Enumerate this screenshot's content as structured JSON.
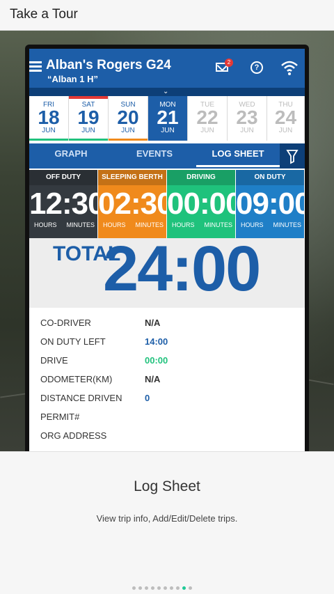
{
  "window": {
    "title": "Take a Tour"
  },
  "app": {
    "driver_name": "Alban's Rogers G24",
    "driver_sub": "“Alban 1 H”",
    "mail_badge": "2",
    "help_glyph": "?"
  },
  "days": [
    {
      "dow": "FRI",
      "num": "18",
      "mon": "JUN"
    },
    {
      "dow": "SAT",
      "num": "19",
      "mon": "JUN"
    },
    {
      "dow": "SUN",
      "num": "20",
      "mon": "JUN"
    },
    {
      "dow": "MON",
      "num": "21",
      "mon": "JUN"
    },
    {
      "dow": "TUE",
      "num": "22",
      "mon": "JUN"
    },
    {
      "dow": "WED",
      "num": "23",
      "mon": "JUN"
    },
    {
      "dow": "THU",
      "num": "24",
      "mon": "JUN"
    }
  ],
  "tabs": [
    {
      "label": "GRAPH"
    },
    {
      "label": "EVENTS"
    },
    {
      "label": "LOG SHEET"
    }
  ],
  "statuses": [
    {
      "label": "OFF DUTY",
      "time": "12:30",
      "color": "#343a40"
    },
    {
      "label": "SLEEPING BERTH",
      "time": "02:30",
      "color": "#f08a1c"
    },
    {
      "label": "DRIVING",
      "time": "00:00",
      "color": "#1fc27c"
    },
    {
      "label": "ON DUTY",
      "time": "09:00",
      "color": "#1f7fc7"
    }
  ],
  "units": {
    "hours": "HOURS",
    "minutes": "MINUTES"
  },
  "total": {
    "label": "TOTAL",
    "value": "24:00"
  },
  "info": [
    {
      "key": "CO-DRIVER",
      "value": "N/A",
      "color": "#333333"
    },
    {
      "key": "ON DUTY LEFT",
      "value": "14:00",
      "color": "#1d5ea8"
    },
    {
      "key": "DRIVE",
      "value": "00:00",
      "color": "#21c27d"
    },
    {
      "key": "ODOMETER(KM)",
      "value": "N/A",
      "color": "#333333"
    },
    {
      "key": "DISTANCE DRIVEN",
      "value": "0",
      "color": "#1d5ea8"
    },
    {
      "key": "PERMIT#",
      "value": "",
      "color": "#333333"
    },
    {
      "key": "ORG ADDRESS",
      "value": "",
      "color": "#333333"
    }
  ],
  "tour": {
    "title": "Log Sheet",
    "description": "View trip info, Add/Edit/Delete trips.",
    "page_count": 10,
    "current_page": 8
  },
  "colors": {
    "brand_blue": "#1d5ea8",
    "dark_blue": "#0d3f78",
    "alert_red": "#e53935",
    "green": "#21c27d"
  }
}
